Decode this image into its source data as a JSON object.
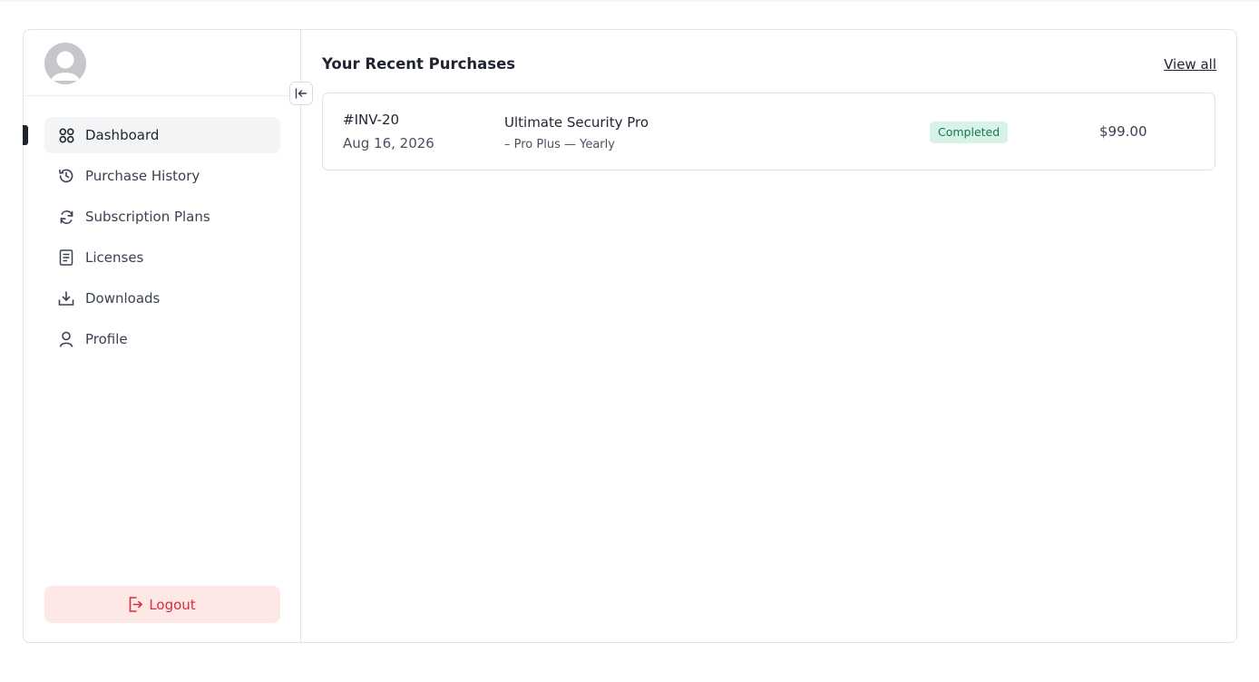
{
  "sidebar": {
    "items": [
      {
        "label": "Dashboard",
        "icon": "grid-icon",
        "active": true
      },
      {
        "label": "Purchase History",
        "icon": "history-icon",
        "active": false
      },
      {
        "label": "Subscription Plans",
        "icon": "refresh-icon",
        "active": false
      },
      {
        "label": "Licenses",
        "icon": "document-icon",
        "active": false
      },
      {
        "label": "Downloads",
        "icon": "download-icon",
        "active": false
      },
      {
        "label": "Profile",
        "icon": "user-icon",
        "active": false
      }
    ],
    "logout_label": "Logout"
  },
  "main": {
    "title": "Your Recent Purchases",
    "view_all_label": "View all",
    "purchases": [
      {
        "invoice": "#INV-20",
        "date": "Aug 16, 2026",
        "product": "Ultimate Security Pro",
        "plan": "– Pro Plus — Yearly",
        "status": "Completed",
        "amount": "$99.00"
      }
    ]
  },
  "colors": {
    "active_bg": "#f3f4f6",
    "logout_bg": "#fde8e6",
    "logout_text": "#d92c3c",
    "status_bg": "#d7f2e7",
    "status_text": "#137a4c"
  }
}
